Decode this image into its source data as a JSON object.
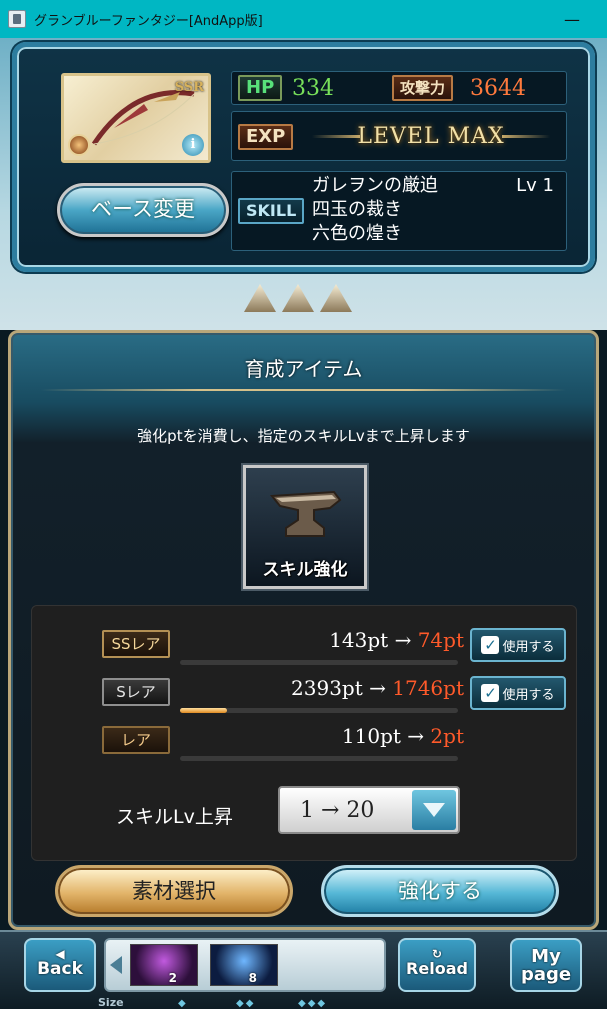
{
  "window": {
    "title": "グランブルーファンタジー[AndApp版]",
    "minimize": "—"
  },
  "character": {
    "rarity": "SSR",
    "hp_label": "HP",
    "hp": "334",
    "atk_label": "攻撃力",
    "atk": "3644",
    "exp_label": "EXP",
    "exp_status": "LEVEL MAX",
    "skill_label": "SKILL",
    "skills": [
      {
        "name": "ガレヲンの厳迫",
        "level": "Lv 1"
      },
      {
        "name": "四玉の裁き",
        "level": ""
      },
      {
        "name": "六色の煌き",
        "level": ""
      }
    ],
    "base_change_label": "ベース変更"
  },
  "panel": {
    "title": "育成アイテム",
    "description": "強化ptを消費し、指定のスキルLvまで上昇します",
    "item_label": "スキル強化"
  },
  "rarities": [
    {
      "label": "SSレア",
      "before": "143pt",
      "arrow": "→",
      "after": "74pt",
      "use_label": "使用する",
      "check": "✓",
      "progress": 0
    },
    {
      "label": "Sレア",
      "before": "2393pt",
      "arrow": "→",
      "after": "1746pt",
      "use_label": "使用する",
      "check": "✓",
      "progress": 0.17
    },
    {
      "label": "レア",
      "before": "110pt",
      "arrow": "→",
      "after": "2pt",
      "progress": 0
    }
  ],
  "skill_level": {
    "label": "スキルLv上昇",
    "value": "1 → 20"
  },
  "actions": {
    "material_select": "素材選択",
    "enhance": "強化する"
  },
  "nav": {
    "back": "Back",
    "reload": "Reload",
    "mypage_line1": "My",
    "mypage_line2": "page",
    "quick_slots": [
      {
        "count": "2",
        "icon": "sword-item-icon"
      },
      {
        "count": "8",
        "icon": "orb-item-icon"
      }
    ],
    "size_label": "Size",
    "size_options": [
      "◆",
      "◆◆",
      "◆◆◆"
    ]
  },
  "colors": {
    "titlebar": "#00b7c3",
    "point_after": "#ff5a2a",
    "hp_value": "#78e05a",
    "atk_value": "#ff7a3d"
  }
}
